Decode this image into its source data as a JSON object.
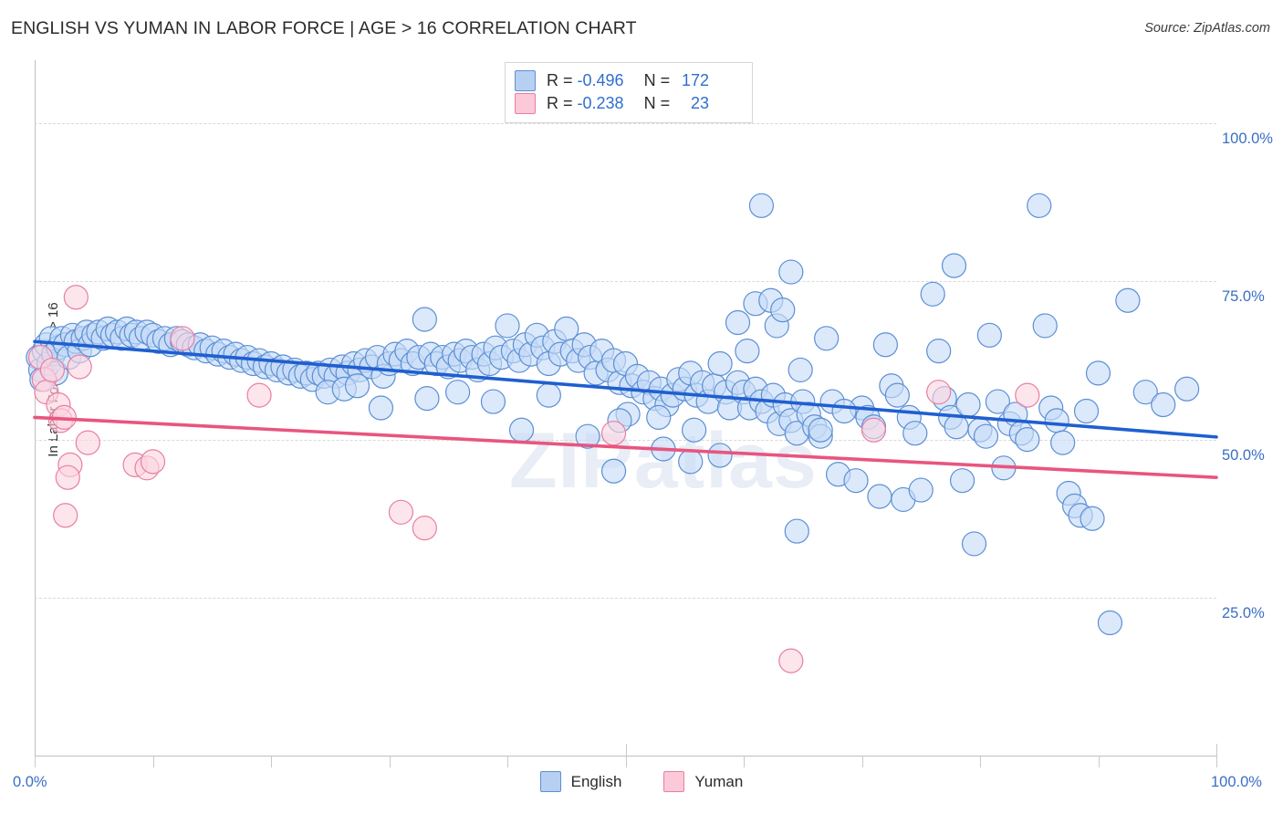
{
  "header": {
    "title": "ENGLISH VS YUMAN IN LABOR FORCE | AGE > 16 CORRELATION CHART",
    "source": "Source: ZipAtlas.com"
  },
  "watermark": "ZIPatlas",
  "stats": {
    "rows": [
      {
        "series": "English",
        "r_label": "R =",
        "r_value": "-0.496",
        "n_label": "N =",
        "n_value": "172",
        "color": "#b7d0f2"
      },
      {
        "series": "Yuman",
        "r_label": "R =",
        "r_value": "-0.238",
        "n_label": "N =",
        "n_value": "23",
        "color": "#fbc9d8"
      }
    ]
  },
  "legend": {
    "items": [
      {
        "label": "English",
        "color": "#b7d0f2"
      },
      {
        "label": "Yuman",
        "color": "#fbc9d8"
      }
    ]
  },
  "axes": {
    "y_title": "In Labor Force | Age > 16",
    "y_ticks": [
      "100.0%",
      "75.0%",
      "50.0%",
      "25.0%"
    ],
    "y_tick_values": [
      100,
      75,
      50,
      25
    ],
    "x_ticks": [
      "0.0%",
      "100.0%"
    ],
    "x_tick_values": [
      0,
      100
    ]
  },
  "chart_data": {
    "type": "scatter",
    "title": "ENGLISH VS YUMAN IN LABOR FORCE | AGE > 16 CORRELATION CHART",
    "xlabel": "",
    "ylabel": "In Labor Force | Age > 16",
    "xlim": [
      0,
      100
    ],
    "ylim": [
      0,
      110
    ],
    "grid": "horizontal-dashed",
    "legend_position": "bottom-center",
    "colors": {
      "english_fill": "#c6dcf7",
      "english_stroke": "#5b8fd6",
      "yuman_fill": "#fbd5e1",
      "yuman_stroke": "#e87fa3",
      "english_line": "#1f5fd0",
      "yuman_line": "#e8557f",
      "tick_text": "#3a6fc4"
    },
    "series": [
      {
        "name": "English",
        "r": -0.496,
        "n": 172,
        "trendline": {
          "x0": 0,
          "y0": 65.5,
          "x1": 100,
          "y1": 50.4
        },
        "points": [
          [
            0.3,
            63.0
          ],
          [
            0.5,
            61.0
          ],
          [
            0.6,
            59.5
          ],
          [
            0.8,
            64.0
          ],
          [
            1.0,
            65.0
          ],
          [
            1.2,
            62.0
          ],
          [
            1.4,
            66.0
          ],
          [
            1.6,
            63.5
          ],
          [
            1.8,
            60.5
          ],
          [
            2.0,
            64.5
          ],
          [
            2.3,
            66.0
          ],
          [
            2.6,
            65.0
          ],
          [
            2.9,
            63.0
          ],
          [
            3.2,
            66.5
          ],
          [
            3.5,
            65.5
          ],
          [
            3.8,
            64.0
          ],
          [
            4.1,
            66.0
          ],
          [
            4.4,
            67.0
          ],
          [
            4.7,
            65.0
          ],
          [
            5.0,
            66.5
          ],
          [
            5.4,
            67.0
          ],
          [
            5.8,
            66.0
          ],
          [
            6.2,
            67.5
          ],
          [
            6.6,
            66.5
          ],
          [
            7.0,
            67.0
          ],
          [
            7.4,
            66.0
          ],
          [
            7.8,
            67.5
          ],
          [
            8.2,
            66.5
          ],
          [
            8.6,
            67.0
          ],
          [
            9.0,
            66.0
          ],
          [
            9.5,
            67.0
          ],
          [
            10.0,
            66.5
          ],
          [
            10.5,
            65.5
          ],
          [
            11.0,
            66.0
          ],
          [
            11.5,
            65.0
          ],
          [
            12.0,
            66.0
          ],
          [
            12.5,
            65.5
          ],
          [
            13.0,
            65.0
          ],
          [
            13.5,
            64.5
          ],
          [
            14.0,
            65.0
          ],
          [
            14.5,
            64.0
          ],
          [
            15.0,
            64.5
          ],
          [
            15.5,
            63.5
          ],
          [
            16.0,
            64.0
          ],
          [
            16.5,
            63.0
          ],
          [
            17.0,
            63.5
          ],
          [
            17.5,
            62.5
          ],
          [
            18.0,
            63.0
          ],
          [
            18.5,
            62.0
          ],
          [
            19.0,
            62.5
          ],
          [
            19.5,
            61.5
          ],
          [
            20.0,
            62.0
          ],
          [
            20.5,
            61.0
          ],
          [
            21.0,
            61.5
          ],
          [
            21.5,
            60.5
          ],
          [
            22.0,
            61.0
          ],
          [
            22.5,
            60.0
          ],
          [
            23.0,
            60.5
          ],
          [
            23.5,
            59.5
          ],
          [
            24.0,
            60.5
          ],
          [
            24.5,
            60.0
          ],
          [
            25.0,
            61.0
          ],
          [
            25.5,
            60.0
          ],
          [
            26.0,
            61.5
          ],
          [
            26.5,
            60.5
          ],
          [
            27.0,
            62.0
          ],
          [
            27.5,
            61.0
          ],
          [
            28.0,
            62.5
          ],
          [
            28.5,
            61.5
          ],
          [
            29.0,
            63.0
          ],
          [
            24.8,
            57.5
          ],
          [
            26.2,
            58.0
          ],
          [
            27.3,
            58.5
          ],
          [
            29.5,
            60.0
          ],
          [
            30.0,
            62.0
          ],
          [
            30.5,
            63.5
          ],
          [
            31.0,
            62.5
          ],
          [
            31.5,
            64.0
          ],
          [
            32.0,
            62.0
          ],
          [
            32.5,
            63.0
          ],
          [
            33.0,
            69.0
          ],
          [
            33.5,
            63.5
          ],
          [
            34.0,
            62.0
          ],
          [
            34.5,
            63.0
          ],
          [
            35.0,
            61.5
          ],
          [
            35.5,
            63.5
          ],
          [
            36.0,
            62.5
          ],
          [
            36.5,
            64.0
          ],
          [
            37.0,
            63.0
          ],
          [
            37.5,
            61.0
          ],
          [
            29.3,
            55.0
          ],
          [
            33.2,
            56.5
          ],
          [
            35.8,
            57.5
          ],
          [
            38.0,
            63.5
          ],
          [
            38.5,
            62.0
          ],
          [
            39.0,
            64.5
          ],
          [
            39.5,
            63.0
          ],
          [
            40.0,
            68.0
          ],
          [
            40.5,
            64.0
          ],
          [
            41.0,
            62.5
          ],
          [
            41.5,
            65.0
          ],
          [
            42.0,
            63.5
          ],
          [
            42.5,
            66.5
          ],
          [
            43.0,
            64.5
          ],
          [
            43.5,
            62.0
          ],
          [
            44.0,
            65.5
          ],
          [
            44.5,
            63.5
          ],
          [
            45.0,
            67.5
          ],
          [
            45.5,
            64.0
          ],
          [
            46.0,
            62.5
          ],
          [
            38.8,
            56.0
          ],
          [
            41.2,
            51.5
          ],
          [
            43.5,
            57.0
          ],
          [
            46.5,
            65.0
          ],
          [
            47.0,
            63.0
          ],
          [
            47.5,
            60.5
          ],
          [
            48.0,
            64.0
          ],
          [
            48.5,
            61.0
          ],
          [
            49.0,
            62.5
          ],
          [
            49.5,
            59.0
          ],
          [
            50.0,
            62.0
          ],
          [
            50.5,
            58.5
          ],
          [
            51.0,
            60.0
          ],
          [
            51.5,
            57.5
          ],
          [
            52.0,
            59.0
          ],
          [
            52.5,
            56.5
          ],
          [
            53.0,
            58.0
          ],
          [
            53.5,
            55.5
          ],
          [
            54.0,
            57.0
          ],
          [
            54.5,
            59.5
          ],
          [
            50.2,
            54.0
          ],
          [
            52.8,
            53.5
          ],
          [
            55.0,
            58.0
          ],
          [
            55.5,
            60.5
          ],
          [
            56.0,
            57.0
          ],
          [
            56.5,
            59.0
          ],
          [
            57.0,
            56.0
          ],
          [
            57.5,
            58.5
          ],
          [
            58.0,
            62.0
          ],
          [
            58.5,
            57.5
          ],
          [
            46.8,
            50.5
          ],
          [
            49.5,
            53.0
          ],
          [
            53.2,
            48.5
          ],
          [
            55.8,
            51.5
          ],
          [
            58.8,
            55.0
          ],
          [
            59.5,
            59.0
          ],
          [
            60.0,
            57.5
          ],
          [
            60.5,
            55.0
          ],
          [
            61.0,
            58.0
          ],
          [
            61.5,
            56.0
          ],
          [
            49.0,
            45.0
          ],
          [
            55.5,
            46.5
          ],
          [
            58.0,
            47.5
          ],
          [
            62.0,
            54.5
          ],
          [
            62.5,
            57.0
          ],
          [
            63.0,
            52.5
          ],
          [
            63.5,
            55.5
          ],
          [
            64.0,
            53.0
          ],
          [
            64.5,
            51.0
          ],
          [
            65.0,
            56.0
          ],
          [
            59.5,
            68.5
          ],
          [
            61.0,
            71.5
          ],
          [
            62.3,
            72.0
          ],
          [
            62.8,
            68.0
          ],
          [
            63.3,
            70.5
          ],
          [
            60.3,
            64.0
          ],
          [
            64.8,
            61.0
          ],
          [
            65.5,
            54.0
          ],
          [
            66.0,
            52.0
          ],
          [
            66.5,
            50.5
          ],
          [
            61.5,
            87.0
          ],
          [
            64.0,
            76.5
          ],
          [
            67.0,
            66.0
          ],
          [
            67.5,
            56.0
          ],
          [
            68.0,
            44.5
          ],
          [
            69.5,
            43.5
          ],
          [
            70.0,
            55.0
          ],
          [
            70.5,
            53.5
          ],
          [
            71.0,
            52.0
          ],
          [
            71.5,
            41.0
          ],
          [
            64.5,
            35.5
          ],
          [
            66.5,
            51.5
          ],
          [
            68.5,
            54.5
          ],
          [
            72.0,
            65.0
          ],
          [
            72.5,
            58.5
          ],
          [
            73.0,
            57.0
          ],
          [
            73.5,
            40.5
          ],
          [
            74.0,
            53.5
          ],
          [
            74.5,
            51.0
          ],
          [
            75.0,
            42.0
          ],
          [
            76.0,
            73.0
          ],
          [
            76.5,
            64.0
          ],
          [
            77.0,
            56.5
          ],
          [
            77.5,
            53.5
          ],
          [
            78.0,
            52.0
          ],
          [
            78.5,
            43.5
          ],
          [
            79.0,
            55.5
          ],
          [
            79.5,
            33.5
          ],
          [
            80.0,
            51.5
          ],
          [
            80.5,
            50.5
          ],
          [
            77.8,
            77.5
          ],
          [
            80.8,
            66.5
          ],
          [
            81.5,
            56.0
          ],
          [
            82.0,
            45.5
          ],
          [
            82.5,
            52.5
          ],
          [
            83.0,
            54.0
          ],
          [
            83.5,
            51.0
          ],
          [
            84.0,
            50.0
          ],
          [
            85.0,
            87.0
          ],
          [
            85.5,
            68.0
          ],
          [
            86.0,
            55.0
          ],
          [
            86.5,
            53.0
          ],
          [
            87.0,
            49.5
          ],
          [
            87.5,
            41.5
          ],
          [
            88.0,
            39.5
          ],
          [
            88.5,
            38.0
          ],
          [
            89.0,
            54.5
          ],
          [
            89.5,
            37.5
          ],
          [
            90.0,
            60.5
          ],
          [
            91.0,
            21.0
          ],
          [
            92.5,
            72.0
          ],
          [
            94.0,
            57.5
          ],
          [
            95.5,
            55.5
          ],
          [
            97.5,
            58.0
          ]
        ]
      },
      {
        "name": "Yuman",
        "r": -0.238,
        "n": 23,
        "trendline": {
          "x0": 0,
          "y0": 53.5,
          "x1": 100,
          "y1": 44.0
        },
        "points": [
          [
            0.5,
            63.0
          ],
          [
            0.8,
            59.5
          ],
          [
            1.0,
            57.5
          ],
          [
            1.5,
            61.0
          ],
          [
            2.0,
            55.5
          ],
          [
            2.2,
            53.0
          ],
          [
            2.5,
            53.5
          ],
          [
            3.5,
            72.5
          ],
          [
            3.8,
            61.5
          ],
          [
            3.0,
            46.0
          ],
          [
            2.8,
            44.0
          ],
          [
            2.6,
            38.0
          ],
          [
            4.5,
            49.5
          ],
          [
            8.5,
            46.0
          ],
          [
            9.5,
            45.5
          ],
          [
            10.0,
            46.5
          ],
          [
            12.5,
            66.0
          ],
          [
            19.0,
            57.0
          ],
          [
            31.0,
            38.5
          ],
          [
            33.0,
            36.0
          ],
          [
            49.0,
            51.0
          ],
          [
            64.0,
            15.0
          ],
          [
            76.5,
            57.5
          ],
          [
            84.0,
            57.0
          ],
          [
            71.0,
            51.5
          ]
        ]
      }
    ]
  }
}
